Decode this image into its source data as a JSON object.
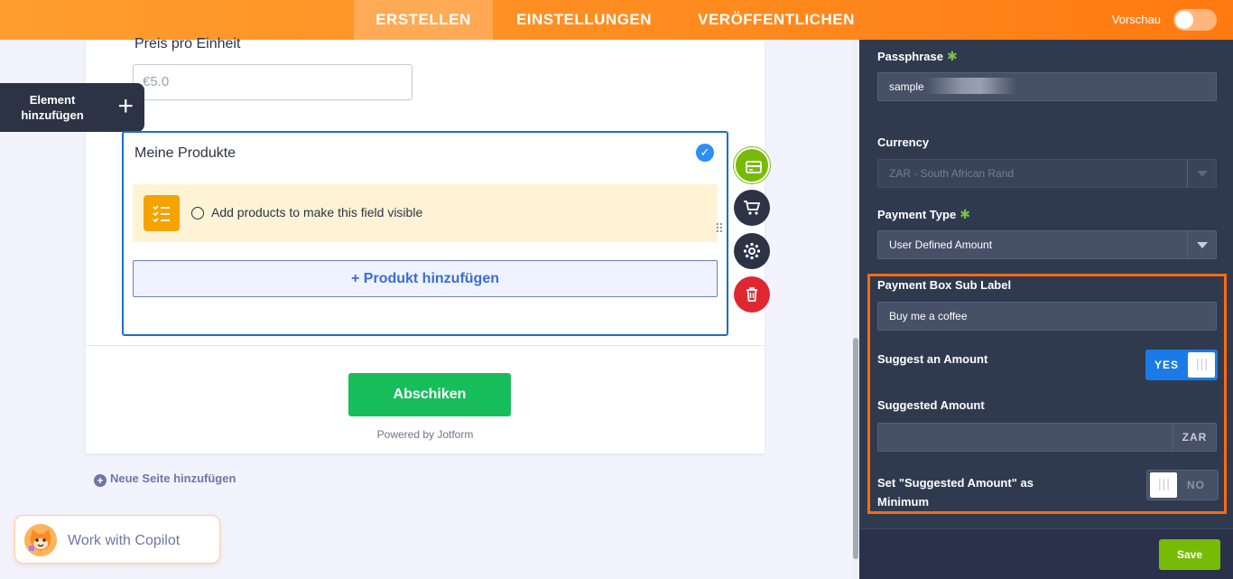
{
  "topbar": {
    "tabs": [
      {
        "label": "ERSTELLEN",
        "active": true
      },
      {
        "label": "EINSTELLUNGEN",
        "active": false
      },
      {
        "label": "VERÖFFENTLICHEN",
        "active": false
      }
    ],
    "preview_label": "Vorschau",
    "preview_on": false
  },
  "canvas": {
    "add_element_line1": "Element",
    "add_element_line2": "hinzufügen",
    "price_label": "Preis pro Einheit",
    "price_placeholder": "€5.0",
    "products": {
      "title": "Meine Produkte",
      "notice": "Add products to make this field visible",
      "add_button": "+ Produkt hinzufügen"
    },
    "submit_label": "Abschiken",
    "powered_by": "Powered by Jotform",
    "new_page_label": "Neue Seite hinzufügen",
    "copilot_label": "Work with Copilot"
  },
  "panel": {
    "passphrase": {
      "label": "Passphrase",
      "value": "sample"
    },
    "currency": {
      "label": "Currency",
      "value": "ZAR - South African Rand"
    },
    "payment_type": {
      "label": "Payment Type",
      "value": "User Defined Amount"
    },
    "sub_label": {
      "label": "Payment Box Sub Label",
      "value": "Buy me a coffee"
    },
    "suggest_amount": {
      "label": "Suggest an Amount",
      "state": "YES"
    },
    "suggested_amount": {
      "label": "Suggested Amount",
      "value": "",
      "suffix": "ZAR"
    },
    "minimum": {
      "label_line1": "Set \"Suggested Amount\" as",
      "label_line2": "Minimum",
      "state": "NO"
    },
    "save_label": "Save"
  },
  "colors": {
    "topbar": "#ff8a1f",
    "panel_bg": "#303a4f",
    "highlight": "#ff6a10",
    "submit": "#18bd5b",
    "save": "#78bb07",
    "toggle_on": "#1a7be6"
  }
}
